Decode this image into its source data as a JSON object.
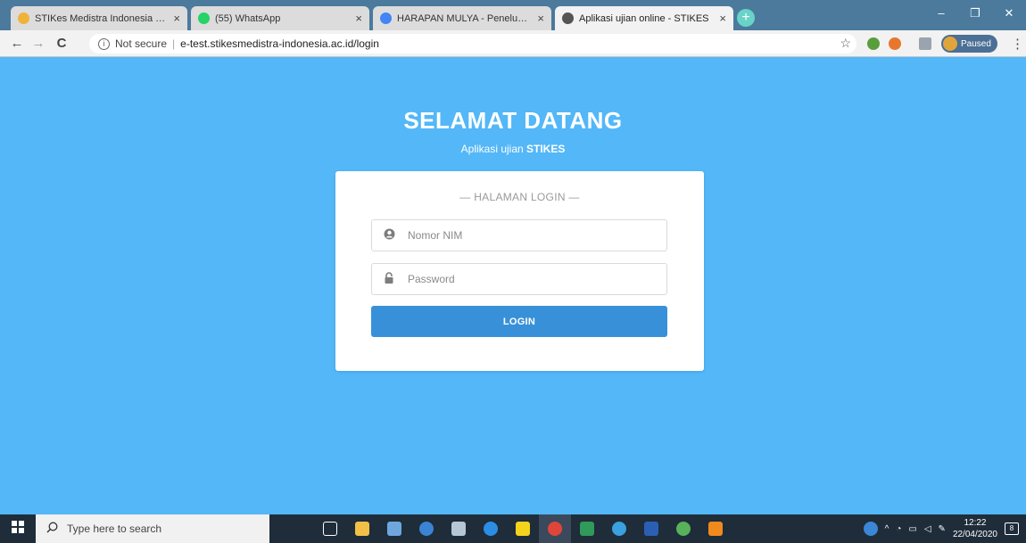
{
  "browser": {
    "tabs": [
      {
        "title": "STIKes Medistra Indonesia - SIM",
        "close": "×",
        "icon_color": "#f0b33a",
        "state": "inactive"
      },
      {
        "title": "(55) WhatsApp",
        "close": "×",
        "icon_color": "#25d366",
        "state": "inactive"
      },
      {
        "title": "HARAPAN MULYA - Penelusuran",
        "close": "×",
        "icon_color": "#4285f4",
        "state": "inactive"
      },
      {
        "title": "Aplikasi ujian online - STIKES",
        "close": "×",
        "icon_color": "#555555",
        "state": "active"
      }
    ],
    "new_tab": "+",
    "window_controls": {
      "minimize": "–",
      "restore": "❐",
      "close": "✕"
    },
    "nav": {
      "back": "←",
      "forward": "→",
      "reload": "C"
    },
    "security_label": "Not secure",
    "separator": "|",
    "url": "e-test.stikesmedistra-indonesia.ac.id/login",
    "profile_label": "Paused",
    "menu": "⋮"
  },
  "page": {
    "title": "SELAMAT DATANG",
    "subtitle_prefix": "Aplikasi ujian ",
    "subtitle_bold": "STIKES",
    "login_card": {
      "heading": "— HALAMAN LOGIN —",
      "nim_placeholder": "Nomor NIM",
      "password_placeholder": "Password",
      "submit_label": "LOGIN"
    }
  },
  "taskbar": {
    "search_placeholder": "Type here to search",
    "time": "12:22",
    "date": "22/04/2020",
    "notification_count": "8"
  },
  "colors": {
    "page_background": "#53b7f8",
    "login_button": "#3891d8",
    "card": "#ffffff",
    "tabbar": "#4b7a9d",
    "taskbar": "#1f2c3a"
  }
}
